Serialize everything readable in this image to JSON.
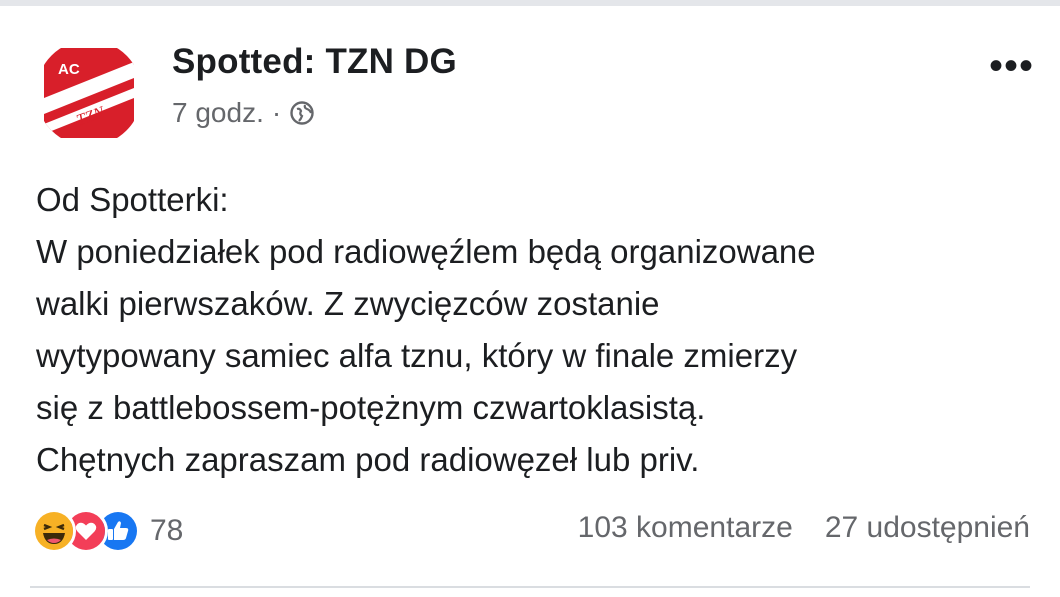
{
  "post": {
    "page_name": "Spotted: TZN DG",
    "time": "7 godz.",
    "separator": "·",
    "privacy_icon": "globe-icon",
    "more_icon": "more-options-icon",
    "more_label": "•••",
    "avatar_icon": "tzn-logo-icon",
    "lines": [
      "Od Spotterki:",
      "W poniedziałek pod radiowęźlem będą organizowane",
      "walki pierwszaków. Z zwycięzców zostanie",
      "wytypowany samiec alfa tznu, który w finale zmierzy",
      "się z battlebossem-potężnym czwartoklasistą.",
      "Chętnych zapraszam pod radiowęzeł lub priv."
    ]
  },
  "reactions": {
    "icons": [
      "haha-icon",
      "love-icon",
      "like-icon"
    ],
    "count": "78"
  },
  "stats": {
    "comments": "103 komentarze",
    "shares": "27 udostępnień"
  },
  "colors": {
    "brand_red": "#d81f2a",
    "like_blue": "#1877f2",
    "love_red": "#f33e58",
    "haha_yellow": "#f7b125",
    "secondary_text": "#65676b"
  }
}
